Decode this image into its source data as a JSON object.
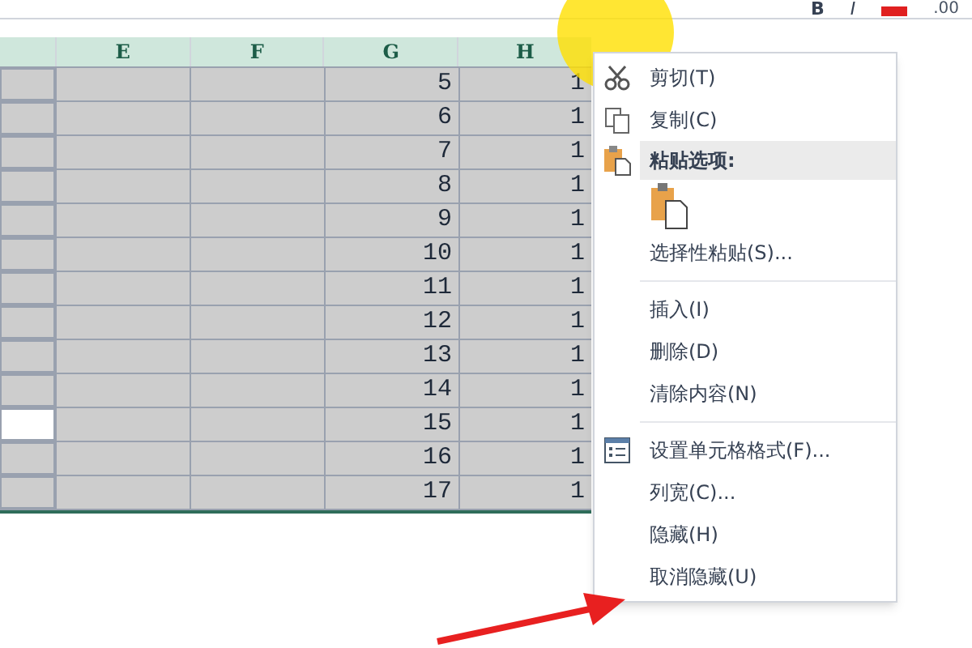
{
  "toolbar": {
    "bold": "B",
    "italic": "I",
    "decimals": ".00"
  },
  "columns": [
    "E",
    "F",
    "G",
    "H"
  ],
  "rows": [
    {
      "g": "5",
      "h": "1",
      "d_selected": true
    },
    {
      "g": "6",
      "h": "1",
      "d_selected": true
    },
    {
      "g": "7",
      "h": "1",
      "d_selected": true
    },
    {
      "g": "8",
      "h": "1",
      "d_selected": true
    },
    {
      "g": "9",
      "h": "1",
      "d_selected": true
    },
    {
      "g": "10",
      "h": "1",
      "d_selected": true
    },
    {
      "g": "11",
      "h": "1",
      "d_selected": true
    },
    {
      "g": "12",
      "h": "1",
      "d_selected": true
    },
    {
      "g": "13",
      "h": "1",
      "d_selected": true
    },
    {
      "g": "14",
      "h": "1",
      "d_selected": true
    },
    {
      "g": "15",
      "h": "1",
      "d_selected": false
    },
    {
      "g": "16",
      "h": "1",
      "d_selected": true
    },
    {
      "g": "17",
      "h": "1",
      "d_selected": true
    }
  ],
  "context_menu": [
    {
      "kind": "item",
      "label": "剪切(T)"
    },
    {
      "kind": "item",
      "label": "复制(C)"
    },
    {
      "kind": "header",
      "label": "粘贴选项:"
    },
    {
      "kind": "paste_option"
    },
    {
      "kind": "item",
      "label": "选择性粘贴(S)..."
    },
    {
      "kind": "separator"
    },
    {
      "kind": "item",
      "label": "插入(I)"
    },
    {
      "kind": "item",
      "label": "删除(D)"
    },
    {
      "kind": "item",
      "label": "清除内容(N)"
    },
    {
      "kind": "separator"
    },
    {
      "kind": "item",
      "label": "设置单元格格式(F)..."
    },
    {
      "kind": "item",
      "label": "列宽(C)..."
    },
    {
      "kind": "item",
      "label": "隐藏(H)"
    },
    {
      "kind": "item",
      "label": "取消隐藏(U)"
    }
  ]
}
